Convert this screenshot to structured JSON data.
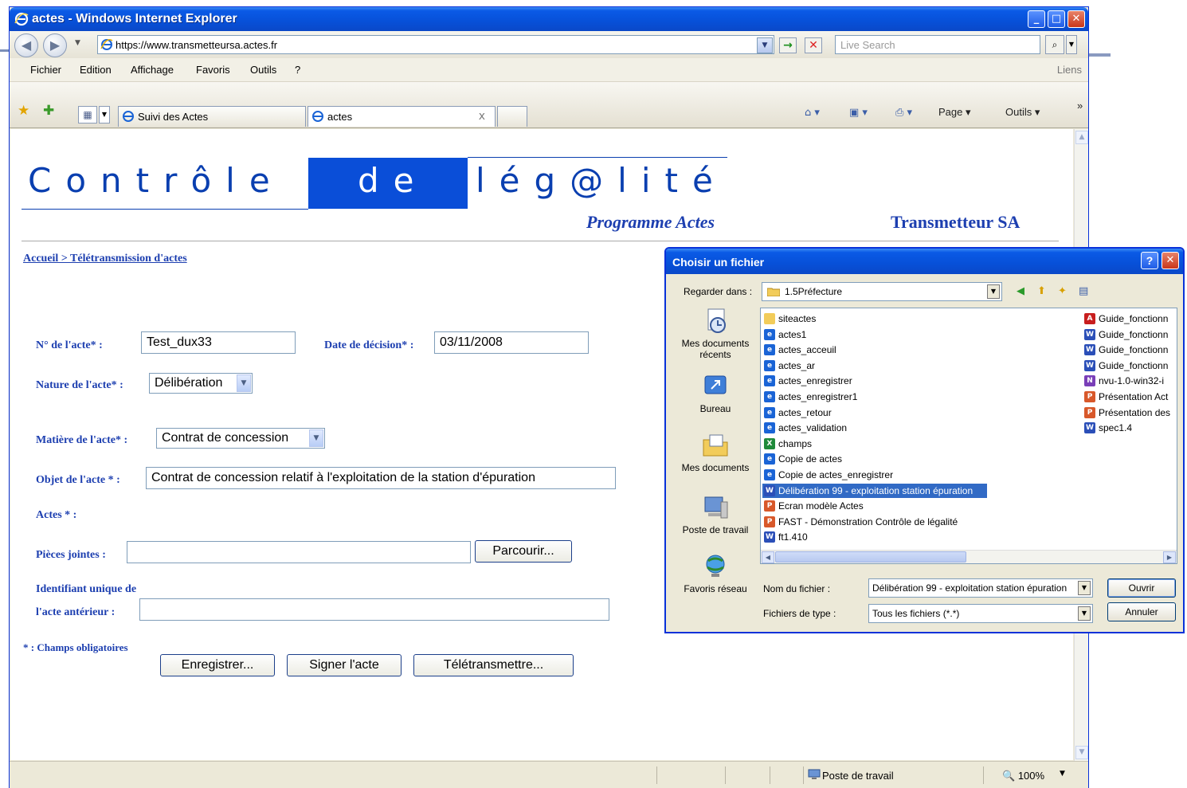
{
  "window": {
    "title": "actes - Windows Internet Explorer",
    "minimize": "_",
    "maximize": "□",
    "close": "✕"
  },
  "toolbar": {
    "back": "◀",
    "forward": "▶",
    "dropdown": "▼",
    "url": "https://www.transmetteursa.actes.fr",
    "address_dropdown": "▼",
    "go": "→",
    "stop": "✕",
    "search_placeholder": "Live Search",
    "search_go": "⌕",
    "search_dropdown": "▼"
  },
  "menu": {
    "items": [
      "Fichier",
      "Edition",
      "Affichage",
      "Favoris",
      "Outils",
      "?"
    ],
    "links": "Liens"
  },
  "tabs": {
    "items": [
      {
        "label": "Suivi des Actes"
      },
      {
        "label": "actes",
        "close": "x"
      }
    ],
    "quick_tabs": "▦",
    "tab_list": "▼"
  },
  "command_bar": {
    "home": "⌂ ▾",
    "feeds": "▣ ▾",
    "print": "⎙ ▾",
    "page": "Page ▾",
    "tools": "Outils ▾",
    "more": "»"
  },
  "status_bar": {
    "zone": "Poste de travail",
    "zoom": "100%",
    "zoom_dropdown": "▼"
  },
  "page": {
    "banner": {
      "word1": "Contrôle",
      "word2": "de",
      "word3": "lég@lité"
    },
    "programme": "Programme Actes",
    "company": "Transmetteur SA",
    "breadcrumb": "Accueil > Télétransmission d'actes",
    "form": {
      "numero_label": "N° de l'acte* :",
      "numero_value": "Test_dux33",
      "date_label": "Date de décision* :",
      "date_value": "03/11/2008",
      "nature_label": "Nature de l'acte* :",
      "nature_value": "Délibération",
      "matiere_label": "Matière de l'acte* :",
      "matiere_value": "Contrat de concession",
      "objet_label": "Objet de l'acte * :",
      "objet_value": "Contrat de concession relatif à l'exploitation de la station d'épuration",
      "actes_label": "Actes * :",
      "pieces_label": "Pièces jointes :",
      "pieces_value": "",
      "browse_button": "Parcourir...",
      "identifiant_label_1": "Identifiant unique de",
      "identifiant_label_2": "l'acte antérieur :",
      "identifiant_value": "",
      "required_note": "* : Champs obligatoires",
      "save_button": "Enregistrer...",
      "sign_button": "Signer l'acte",
      "transmit_button": "Télétransmettre..."
    }
  },
  "dialog": {
    "title": "Choisir un fichier",
    "help": "?",
    "close": "✕",
    "look_in_label": "Regarder dans :",
    "look_in_value": "1.5Préfecture",
    "places": [
      {
        "label": "Mes documents récents"
      },
      {
        "label": "Bureau"
      },
      {
        "label": "Mes documents"
      },
      {
        "label": "Poste de travail"
      },
      {
        "label": "Favoris réseau"
      }
    ],
    "files_col1": [
      {
        "name": "siteactes",
        "type": "folder"
      },
      {
        "name": "actes1",
        "type": "ie"
      },
      {
        "name": "actes_acceuil",
        "type": "ie"
      },
      {
        "name": "actes_ar",
        "type": "ie"
      },
      {
        "name": "actes_enregistrer",
        "type": "ie"
      },
      {
        "name": "actes_enregistrer1",
        "type": "ie"
      },
      {
        "name": "actes_retour",
        "type": "ie"
      },
      {
        "name": "actes_validation",
        "type": "ie"
      },
      {
        "name": "champs",
        "type": "excel"
      },
      {
        "name": "Copie de actes",
        "type": "ie"
      },
      {
        "name": "Copie de actes_enregistrer",
        "type": "ie"
      },
      {
        "name": "Délibération 99 - exploitation station épuration",
        "type": "word",
        "selected": true
      },
      {
        "name": "Ecran modèle Actes",
        "type": "ppt"
      },
      {
        "name": "FAST - Démonstration Contrôle de légalité",
        "type": "ppt"
      },
      {
        "name": "ft1.410",
        "type": "word"
      }
    ],
    "files_col2": [
      {
        "name": "Guide_fonctionn",
        "type": "pdf"
      },
      {
        "name": "Guide_fonctionn",
        "type": "word"
      },
      {
        "name": "Guide_fonctionn",
        "type": "word"
      },
      {
        "name": "Guide_fonctionn",
        "type": "word"
      },
      {
        "name": "nvu-1.0-win32-i",
        "type": "exe"
      },
      {
        "name": "Présentation Act",
        "type": "ppt"
      },
      {
        "name": "Présentation des",
        "type": "ppt"
      },
      {
        "name": "spec1.4",
        "type": "word"
      }
    ],
    "file_name_label": "Nom du fichier :",
    "file_name_value": "Délibération 99 - exploitation station épuration",
    "file_type_label": "Fichiers de type :",
    "file_type_value": "Tous les fichiers (*.*)",
    "open_button": "Ouvrir",
    "cancel_button": "Annuler"
  },
  "colors": {
    "xp_blue": "#0a5ae6",
    "banner_blue": "#0a4ed8",
    "label_blue": "#1d3fb0",
    "selection": "#316ac5"
  }
}
